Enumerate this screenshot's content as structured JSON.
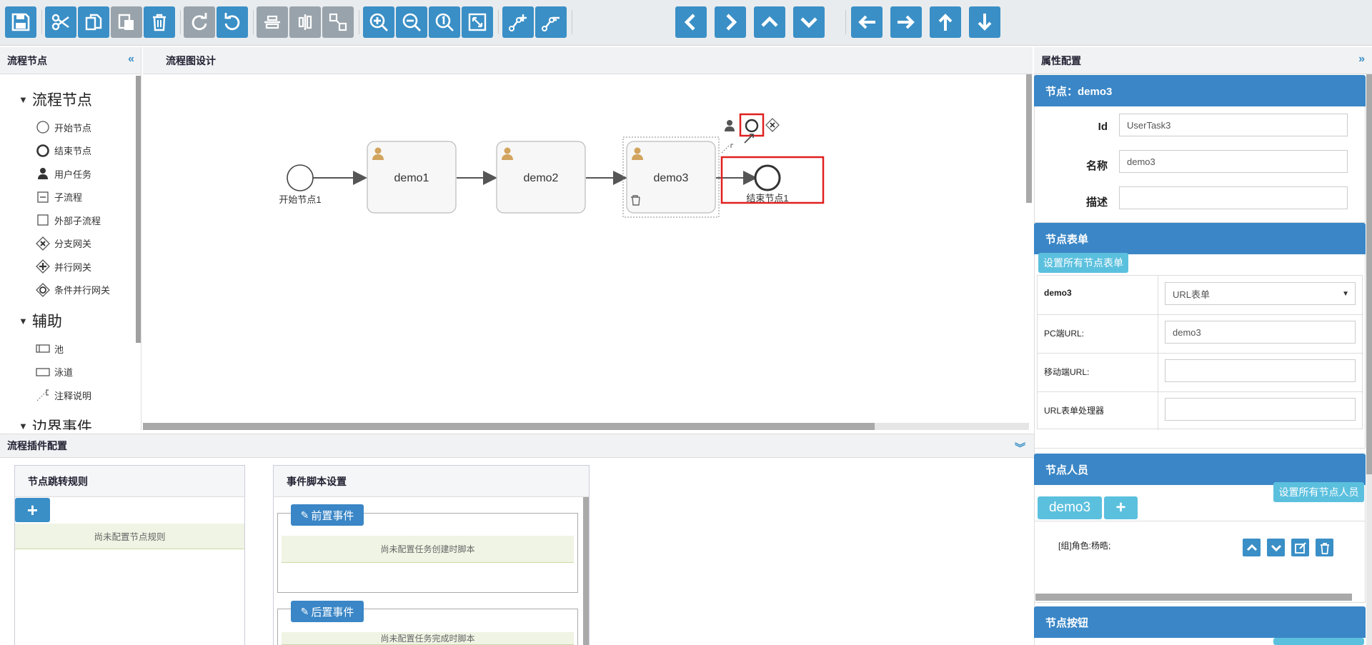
{
  "toolbar": {
    "buttons": [
      "save",
      "cut",
      "copy",
      "paste",
      "delete",
      "redo",
      "undo",
      "align-horizontal",
      "align-vertical",
      "same-size",
      "zoom-in",
      "zoom-out",
      "zoom-actual",
      "zoom-fit",
      "add-bendpoint",
      "remove-bendpoint",
      "arrow-left",
      "arrow-right",
      "arrow-up",
      "arrow-down",
      "move-left",
      "move-right",
      "move-up",
      "move-down"
    ]
  },
  "left_panel": {
    "title": "流程节点",
    "groups": [
      {
        "label": "流程节点",
        "items": [
          "开始节点",
          "结束节点",
          "用户任务",
          "子流程",
          "外部子流程",
          "分支网关",
          "并行网关",
          "条件并行网关"
        ]
      },
      {
        "label": "辅助",
        "items": [
          "池",
          "泳道",
          "注释说明"
        ]
      },
      {
        "label": "边界事件",
        "items": []
      }
    ]
  },
  "designer": {
    "title": "流程图设计",
    "nodes": {
      "start": "开始节点1",
      "task1": "demo1",
      "task2": "demo2",
      "task3": "demo3",
      "end": "结束节点1"
    }
  },
  "properties": {
    "title": "属性配置",
    "node_section": {
      "title": "节点：demo3",
      "id_label": "Id",
      "id_value": "UserTask3",
      "name_label": "名称",
      "name_value": "demo3",
      "desc_label": "描述",
      "desc_value": ""
    },
    "form_section": {
      "title": "节点表单",
      "set_all_button": "设置所有节点表单",
      "node_name": "demo3",
      "form_type": "URL表单",
      "pc_url_label": "PC端URL:",
      "pc_url_value": "demo3",
      "mobile_url_label": "移动端URL:",
      "mobile_url_value": "",
      "handler_label": "URL表单处理器",
      "handler_value": ""
    },
    "people_section": {
      "title": "节点人员",
      "set_all_button": "设置所有节点人员",
      "tab_label": "demo3",
      "add_label": "+",
      "assignee": "[组]角色:杨晧;"
    },
    "buttons_section": {
      "title": "节点按钮"
    }
  },
  "plugins": {
    "title": "流程插件配置",
    "jump_rules": {
      "title": "节点跳转规则",
      "add_label": "+",
      "empty_text": "尚未配置节点规则"
    },
    "scripts": {
      "title": "事件脚本设置",
      "pre_event": "前置事件",
      "pre_empty": "尚未配置任务创建时脚本",
      "post_event": "后置事件",
      "post_empty": "尚未配置任务完成时脚本"
    }
  },
  "colors": {
    "accent": "#3a8fc6",
    "highlight": "#e02020",
    "section": "#3a86c6",
    "cyan": "#5bc0de"
  }
}
